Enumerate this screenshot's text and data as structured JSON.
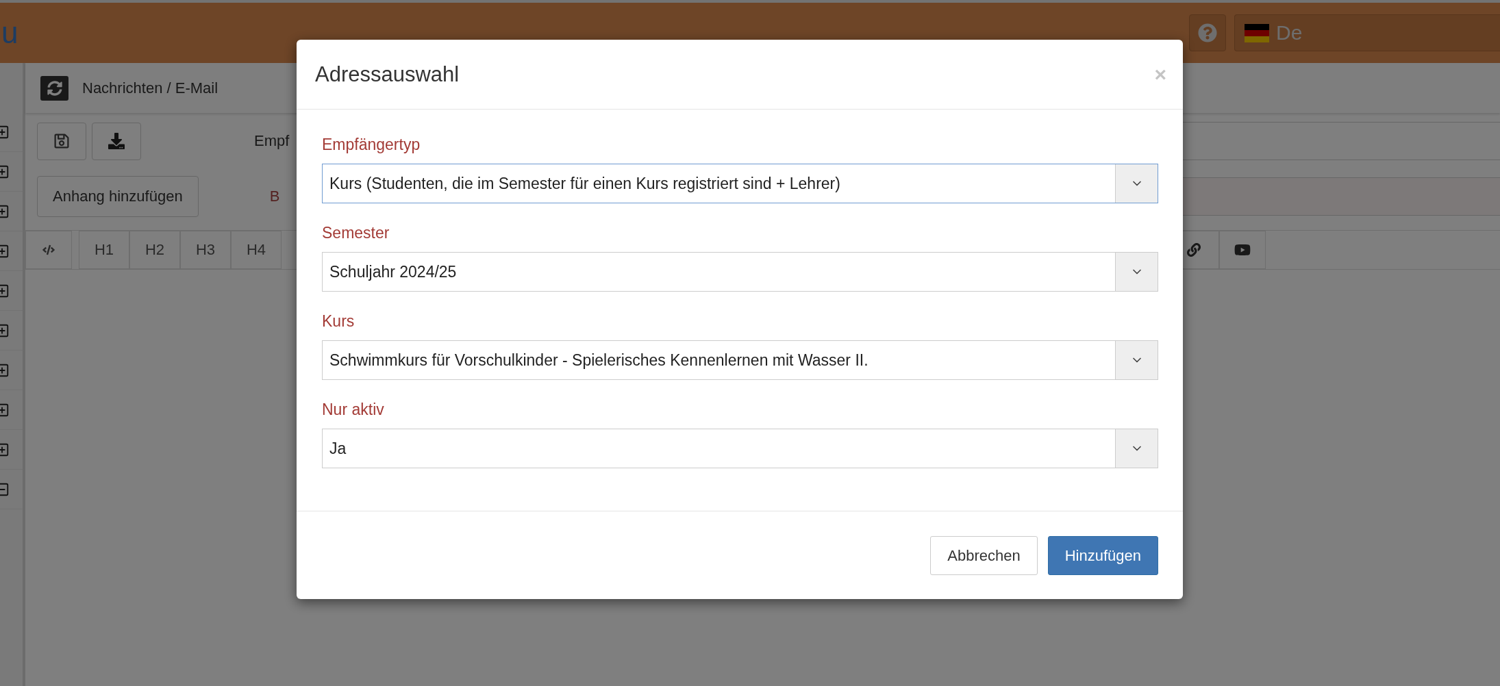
{
  "header": {
    "logo_fragment": "u",
    "language": "De"
  },
  "sidebar": {
    "items": [
      {
        "expanded": false
      },
      {
        "expanded": false
      },
      {
        "expanded": false
      },
      {
        "expanded": false
      },
      {
        "expanded": false
      },
      {
        "expanded": false
      },
      {
        "expanded": false
      },
      {
        "expanded": false
      },
      {
        "expanded": false
      },
      {
        "expanded": true
      }
    ]
  },
  "page": {
    "breadcrumb": "Nachrichten / E-Mail",
    "recipient_label": "Empf",
    "attachment_button": "Anhang hinzufügen",
    "subject_label": "B",
    "editor_toolbar": {
      "heading_buttons": [
        "H1",
        "H2",
        "H3",
        "H4"
      ]
    }
  },
  "modal": {
    "title": "Adressauswahl",
    "close": "×",
    "fields": [
      {
        "label": "Empfängertyp",
        "value": "Kurs (Studenten, die im Semester für einen Kurs registriert sind + Lehrer)",
        "focused": true
      },
      {
        "label": "Semester",
        "value": "Schuljahr 2024/25",
        "focused": false
      },
      {
        "label": "Kurs",
        "value": "Schwimmkurs für Vorschulkinder - Spielerisches Kennenlernen mit Wasser II.",
        "focused": false
      },
      {
        "label": "Nur aktiv",
        "value": "Ja",
        "focused": false
      }
    ],
    "buttons": [
      {
        "label": "Abbrechen",
        "kind": "secondary"
      },
      {
        "label": "Hinzufügen",
        "kind": "primary"
      }
    ]
  }
}
